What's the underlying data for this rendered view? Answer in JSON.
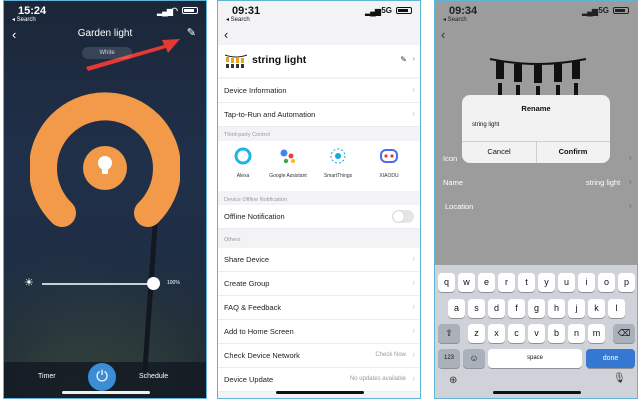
{
  "phone1": {
    "status": {
      "time": "15:24",
      "back": "◂ Search"
    },
    "title": "Garden light",
    "mode": "White",
    "brightness": "100%",
    "brightness_value": 1.0,
    "timer_label": "Timer",
    "schedule_label": "Schedule",
    "colors": {
      "ring": "#f39a4a",
      "bulb": "#f7c58f",
      "power": "#3b8ed6",
      "arrow": "#e53935"
    }
  },
  "phone2": {
    "status": {
      "time": "09:31",
      "back": "◂ Search",
      "network": "5G"
    },
    "device_name": "string light",
    "rows_top": [
      {
        "label": "Device Information"
      },
      {
        "label": "Tap-to-Run and Automation"
      }
    ],
    "section_third_party": "Third-party Control",
    "third_party": [
      {
        "label": "Alexa",
        "icon": "alexa-icon"
      },
      {
        "label": "Google Assistant",
        "icon": "google-assistant-icon"
      },
      {
        "label": "SmartThings",
        "icon": "smartthings-icon"
      },
      {
        "label": "XIAODU",
        "icon": "xiaodu-icon"
      }
    ],
    "section_offline": "Device Offline Notification",
    "offline_label": "Offline Notification",
    "offline_enabled": false,
    "section_others": "Others",
    "rows_others": [
      {
        "label": "Share Device",
        "value": ""
      },
      {
        "label": "Create Group",
        "value": ""
      },
      {
        "label": "FAQ & Feedback",
        "value": ""
      },
      {
        "label": "Add to Home Screen",
        "value": ""
      },
      {
        "label": "Check Device Network",
        "value": "Check Now"
      },
      {
        "label": "Device Update",
        "value": "No updates available"
      }
    ]
  },
  "phone3": {
    "status": {
      "time": "09:34",
      "back": "◂ Search",
      "network": "5G"
    },
    "rows": [
      {
        "label": "Icon",
        "value": ""
      },
      {
        "label": "Name",
        "value": "string light"
      },
      {
        "label": "Location",
        "value": ""
      }
    ],
    "dialog": {
      "title": "Rename",
      "input": "string light",
      "cancel": "Cancel",
      "confirm": "Confirm"
    },
    "keyboard": {
      "row1": [
        "q",
        "w",
        "e",
        "r",
        "t",
        "y",
        "u",
        "i",
        "o",
        "p"
      ],
      "row2": [
        "a",
        "s",
        "d",
        "f",
        "g",
        "h",
        "j",
        "k",
        "l"
      ],
      "row3": [
        "z",
        "x",
        "c",
        "v",
        "b",
        "n",
        "m"
      ],
      "num": "123",
      "space": "space",
      "done": "done"
    }
  }
}
